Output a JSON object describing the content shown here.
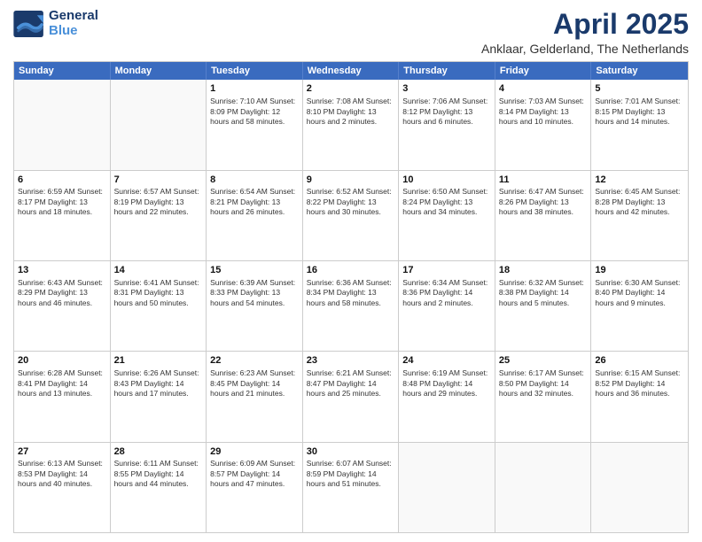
{
  "logo": {
    "line1": "General",
    "line2": "Blue"
  },
  "title": "April 2025",
  "subtitle": "Anklaar, Gelderland, The Netherlands",
  "header_days": [
    "Sunday",
    "Monday",
    "Tuesday",
    "Wednesday",
    "Thursday",
    "Friday",
    "Saturday"
  ],
  "weeks": [
    [
      {
        "day": "",
        "info": ""
      },
      {
        "day": "",
        "info": ""
      },
      {
        "day": "1",
        "info": "Sunrise: 7:10 AM\nSunset: 8:09 PM\nDaylight: 12 hours\nand 58 minutes."
      },
      {
        "day": "2",
        "info": "Sunrise: 7:08 AM\nSunset: 8:10 PM\nDaylight: 13 hours\nand 2 minutes."
      },
      {
        "day": "3",
        "info": "Sunrise: 7:06 AM\nSunset: 8:12 PM\nDaylight: 13 hours\nand 6 minutes."
      },
      {
        "day": "4",
        "info": "Sunrise: 7:03 AM\nSunset: 8:14 PM\nDaylight: 13 hours\nand 10 minutes."
      },
      {
        "day": "5",
        "info": "Sunrise: 7:01 AM\nSunset: 8:15 PM\nDaylight: 13 hours\nand 14 minutes."
      }
    ],
    [
      {
        "day": "6",
        "info": "Sunrise: 6:59 AM\nSunset: 8:17 PM\nDaylight: 13 hours\nand 18 minutes."
      },
      {
        "day": "7",
        "info": "Sunrise: 6:57 AM\nSunset: 8:19 PM\nDaylight: 13 hours\nand 22 minutes."
      },
      {
        "day": "8",
        "info": "Sunrise: 6:54 AM\nSunset: 8:21 PM\nDaylight: 13 hours\nand 26 minutes."
      },
      {
        "day": "9",
        "info": "Sunrise: 6:52 AM\nSunset: 8:22 PM\nDaylight: 13 hours\nand 30 minutes."
      },
      {
        "day": "10",
        "info": "Sunrise: 6:50 AM\nSunset: 8:24 PM\nDaylight: 13 hours\nand 34 minutes."
      },
      {
        "day": "11",
        "info": "Sunrise: 6:47 AM\nSunset: 8:26 PM\nDaylight: 13 hours\nand 38 minutes."
      },
      {
        "day": "12",
        "info": "Sunrise: 6:45 AM\nSunset: 8:28 PM\nDaylight: 13 hours\nand 42 minutes."
      }
    ],
    [
      {
        "day": "13",
        "info": "Sunrise: 6:43 AM\nSunset: 8:29 PM\nDaylight: 13 hours\nand 46 minutes."
      },
      {
        "day": "14",
        "info": "Sunrise: 6:41 AM\nSunset: 8:31 PM\nDaylight: 13 hours\nand 50 minutes."
      },
      {
        "day": "15",
        "info": "Sunrise: 6:39 AM\nSunset: 8:33 PM\nDaylight: 13 hours\nand 54 minutes."
      },
      {
        "day": "16",
        "info": "Sunrise: 6:36 AM\nSunset: 8:34 PM\nDaylight: 13 hours\nand 58 minutes."
      },
      {
        "day": "17",
        "info": "Sunrise: 6:34 AM\nSunset: 8:36 PM\nDaylight: 14 hours\nand 2 minutes."
      },
      {
        "day": "18",
        "info": "Sunrise: 6:32 AM\nSunset: 8:38 PM\nDaylight: 14 hours\nand 5 minutes."
      },
      {
        "day": "19",
        "info": "Sunrise: 6:30 AM\nSunset: 8:40 PM\nDaylight: 14 hours\nand 9 minutes."
      }
    ],
    [
      {
        "day": "20",
        "info": "Sunrise: 6:28 AM\nSunset: 8:41 PM\nDaylight: 14 hours\nand 13 minutes."
      },
      {
        "day": "21",
        "info": "Sunrise: 6:26 AM\nSunset: 8:43 PM\nDaylight: 14 hours\nand 17 minutes."
      },
      {
        "day": "22",
        "info": "Sunrise: 6:23 AM\nSunset: 8:45 PM\nDaylight: 14 hours\nand 21 minutes."
      },
      {
        "day": "23",
        "info": "Sunrise: 6:21 AM\nSunset: 8:47 PM\nDaylight: 14 hours\nand 25 minutes."
      },
      {
        "day": "24",
        "info": "Sunrise: 6:19 AM\nSunset: 8:48 PM\nDaylight: 14 hours\nand 29 minutes."
      },
      {
        "day": "25",
        "info": "Sunrise: 6:17 AM\nSunset: 8:50 PM\nDaylight: 14 hours\nand 32 minutes."
      },
      {
        "day": "26",
        "info": "Sunrise: 6:15 AM\nSunset: 8:52 PM\nDaylight: 14 hours\nand 36 minutes."
      }
    ],
    [
      {
        "day": "27",
        "info": "Sunrise: 6:13 AM\nSunset: 8:53 PM\nDaylight: 14 hours\nand 40 minutes."
      },
      {
        "day": "28",
        "info": "Sunrise: 6:11 AM\nSunset: 8:55 PM\nDaylight: 14 hours\nand 44 minutes."
      },
      {
        "day": "29",
        "info": "Sunrise: 6:09 AM\nSunset: 8:57 PM\nDaylight: 14 hours\nand 47 minutes."
      },
      {
        "day": "30",
        "info": "Sunrise: 6:07 AM\nSunset: 8:59 PM\nDaylight: 14 hours\nand 51 minutes."
      },
      {
        "day": "",
        "info": ""
      },
      {
        "day": "",
        "info": ""
      },
      {
        "day": "",
        "info": ""
      }
    ]
  ]
}
